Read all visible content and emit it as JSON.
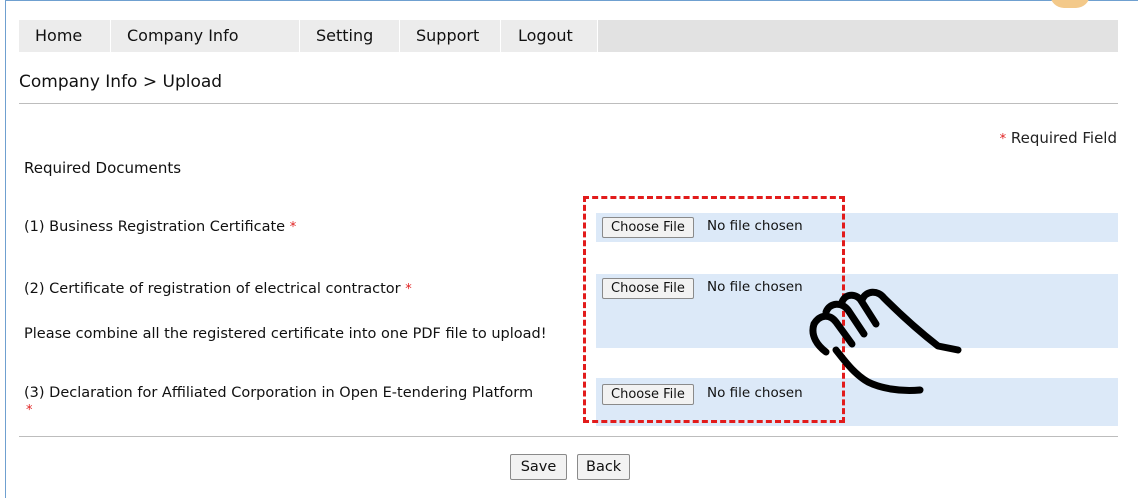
{
  "nav": {
    "items": [
      {
        "label": "Home"
      },
      {
        "label": "Company Info"
      },
      {
        "label": "Setting"
      },
      {
        "label": "Support"
      },
      {
        "label": "Logout"
      }
    ]
  },
  "breadcrumb": "Company Info > Upload",
  "required_note": {
    "star": "*",
    "label": "Required Field"
  },
  "section_title": "Required Documents",
  "documents": [
    {
      "label": "(1) Business Registration Certificate",
      "star": "*",
      "button": "Choose File",
      "status": "No file chosen"
    },
    {
      "label": "(2) Certificate of registration of electrical contractor",
      "star": "*",
      "note": "Please combine all the registered certificate into one PDF file to upload!",
      "button": "Choose File",
      "status": "No file chosen"
    },
    {
      "label": "(3) Declaration for Affiliated Corporation in Open E-tendering Platform",
      "star": "*",
      "button": "Choose File",
      "status": "No file chosen"
    }
  ],
  "actions": {
    "save": "Save",
    "back": "Back"
  },
  "colors": {
    "nav_bg": "#e2e2e2",
    "file_row_bg": "#dce9f8",
    "highlight_dash": "#e21b1b",
    "required_star": "#e02020"
  },
  "annotation_icon": "pointing-hand-icon"
}
